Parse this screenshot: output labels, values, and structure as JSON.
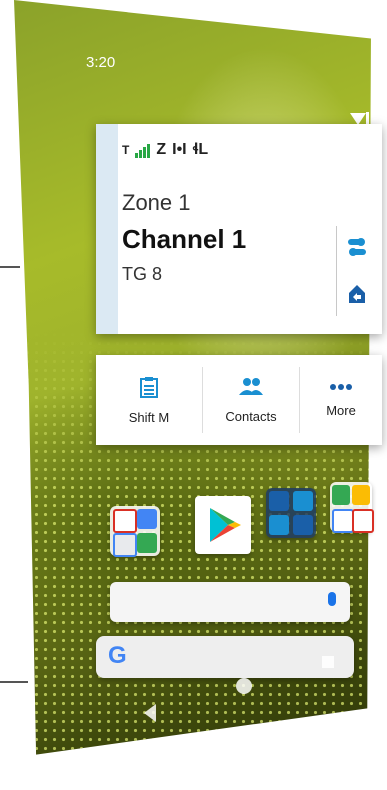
{
  "status_bar": {
    "time": "3:20"
  },
  "radio_widget": {
    "signal_glyphs": [
      "Z",
      "I•I",
      "ɬL"
    ],
    "zone": "Zone 1",
    "channel": "Channel 1",
    "talkgroup": "TG 8"
  },
  "shortcuts": [
    {
      "label": "Shift M",
      "icon": "clipboard-icon"
    },
    {
      "label": "Contacts",
      "icon": "contacts-icon"
    },
    {
      "label": "More",
      "icon": "more-dots-icon"
    }
  ],
  "search": {
    "google_logo": "G"
  },
  "colors": {
    "accent_blue": "#1a8fd1",
    "signal_green": "#28a745"
  }
}
